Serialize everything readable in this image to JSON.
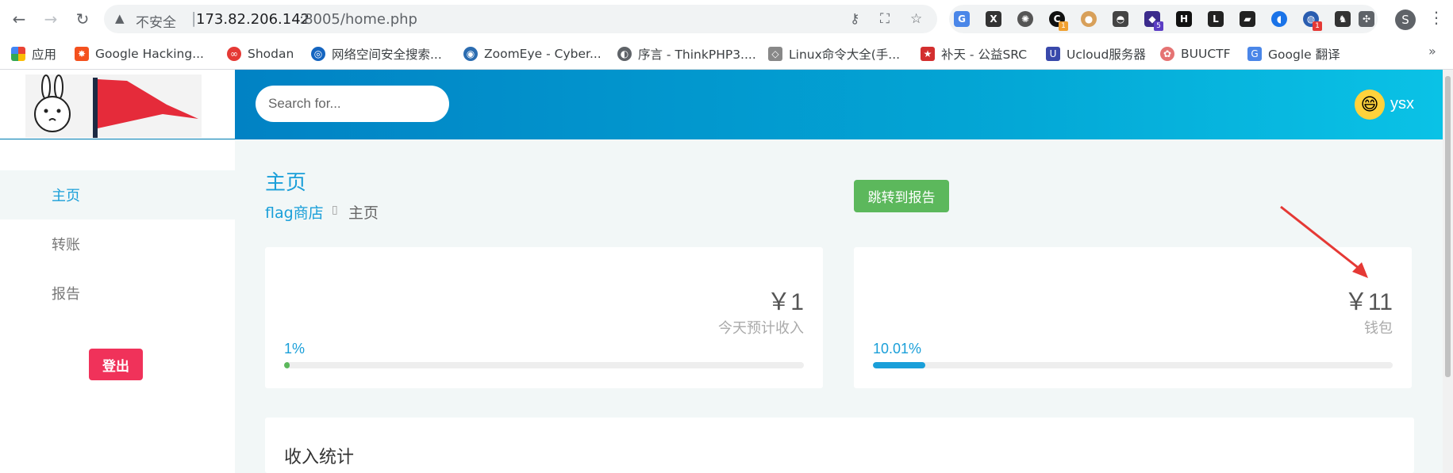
{
  "browser": {
    "security_label": "不安全",
    "url_host": "173.82.206.142",
    "url_path": ":8005/home.php",
    "profile_initial": "S",
    "extension_badges": [
      "1",
      "5",
      "1"
    ]
  },
  "bookmarks": [
    {
      "label": "应用",
      "icon": "apps-grid-icon"
    },
    {
      "label": "Google Hacking...",
      "icon": "google-hacking-icon"
    },
    {
      "label": "Shodan",
      "icon": "shodan-icon"
    },
    {
      "label": "网络空间安全搜索...",
      "icon": "cyberspace-search-icon"
    },
    {
      "label": "ZoomEye - Cyber...",
      "icon": "zoomeye-icon"
    },
    {
      "label": "序言 - ThinkPHP3....",
      "icon": "globe-icon"
    },
    {
      "label": "Linux命令大全(手...",
      "icon": "linux-icon"
    },
    {
      "label": "补天 - 公益SRC",
      "icon": "butian-icon"
    },
    {
      "label": "Ucloud服务器",
      "icon": "ucloud-icon"
    },
    {
      "label": "BUUCTF",
      "icon": "buuctf-icon"
    },
    {
      "label": "Google 翻译",
      "icon": "google-translate-icon"
    }
  ],
  "header": {
    "search_placeholder": "Search for...",
    "username": "ysx"
  },
  "sidebar": {
    "items": [
      {
        "label": "主页",
        "active": true
      },
      {
        "label": "转账",
        "active": false
      },
      {
        "label": "报告",
        "active": false
      }
    ],
    "logout_label": "登出"
  },
  "main": {
    "title": "主页",
    "breadcrumb_shop": "flag商店",
    "breadcrumb_current": "主页",
    "report_button": "跳转到报告",
    "cards": [
      {
        "value": "￥1",
        "label": "今天预计收入",
        "percent_text": "1%",
        "progress": 0.01,
        "bar_color": "#5cb85c"
      },
      {
        "value": "￥11",
        "label": "钱包",
        "percent_text": "10.01%",
        "progress": 0.1001,
        "bar_color": "#1a9fd9"
      }
    ],
    "stats_title": "收入统计"
  },
  "colors": {
    "accent": "#1a9fd9",
    "header_gradient_start": "#0182c4",
    "header_gradient_end": "#0ac2e6",
    "logout": "#f0325a",
    "report_button": "#5cb85c"
  }
}
